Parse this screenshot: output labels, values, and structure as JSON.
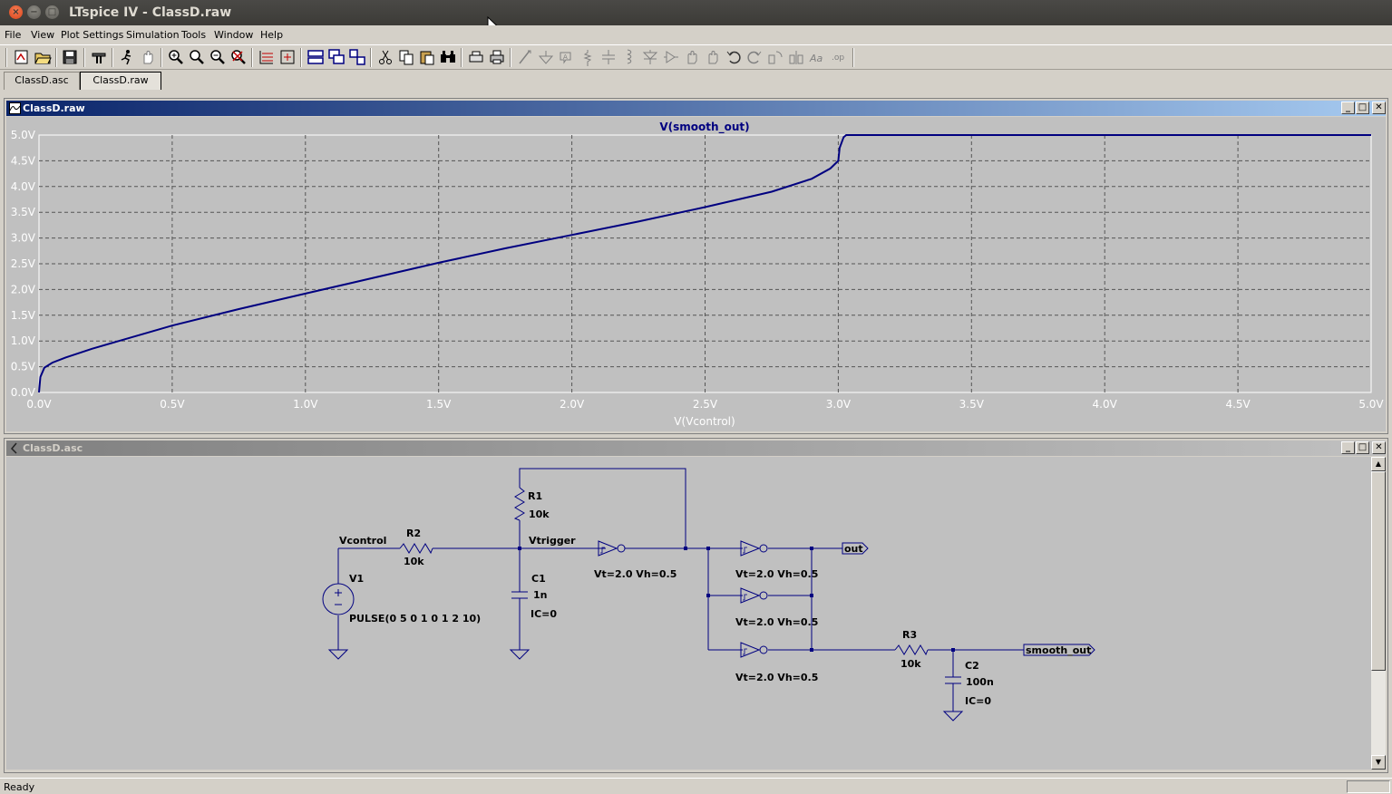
{
  "window": {
    "title": "LTspice IV - ClassD.raw"
  },
  "menu": [
    "File",
    "View",
    "Plot Settings",
    "Simulation",
    "Tools",
    "Window",
    "Help"
  ],
  "toolbar_icons": [
    "new-schematic-icon",
    "open-icon",
    "save-icon",
    "control-panel-icon",
    "run-icon",
    "halt-icon",
    "zoom-in-icon",
    "zoom-pan-icon",
    "zoom-out-icon",
    "zoom-cancel-icon",
    "autorange-icon",
    "zoom-extents-icon",
    "tile-horizontal-icon",
    "cascade-icon",
    "tile-vertical-icon",
    "cut-icon",
    "copy-icon",
    "paste-icon",
    "find-icon",
    "print-setup-icon",
    "print-icon",
    "wire-icon",
    "ground-icon",
    "label-net-icon",
    "resistor-icon",
    "capacitor-icon",
    "inductor-icon",
    "diode-icon",
    "component-icon",
    "move-icon",
    "drag-icon",
    "undo-icon",
    "redo-icon",
    "rotate-icon",
    "mirror-icon",
    "text-icon",
    "spice-directive-icon"
  ],
  "tabs": [
    {
      "label": "ClassD.asc",
      "active": false
    },
    {
      "label": "ClassD.raw",
      "active": true
    }
  ],
  "waveform_window": {
    "title": "ClassD.raw",
    "controls": {
      "minimize": "_",
      "maximize": "□",
      "close": "✕"
    }
  },
  "schematic_window": {
    "title": "ClassD.asc",
    "controls": {
      "minimize": "_",
      "maximize": "□",
      "close": "✕"
    }
  },
  "chart_data": {
    "type": "line",
    "title": "V(smooth_out)",
    "xlabel": "V(Vcontrol)",
    "ylabel": "",
    "xlim": [
      0,
      5
    ],
    "ylim": [
      0,
      5
    ],
    "x_ticks": [
      "0.0V",
      "0.5V",
      "1.0V",
      "1.5V",
      "2.0V",
      "2.5V",
      "3.0V",
      "3.5V",
      "4.0V",
      "4.5V",
      "5.0V"
    ],
    "y_ticks": [
      "0.0V",
      "0.5V",
      "1.0V",
      "1.5V",
      "2.0V",
      "2.5V",
      "3.0V",
      "3.5V",
      "4.0V",
      "4.5V",
      "5.0V"
    ],
    "grid": true,
    "series_color": "#000080",
    "series": [
      {
        "x": [
          0.0,
          0.005,
          0.02,
          0.05,
          0.1,
          0.2,
          0.3,
          0.5,
          0.75,
          1.0,
          1.25,
          1.5,
          1.75,
          2.0,
          2.25,
          2.5,
          2.75,
          2.9,
          2.97,
          3.0,
          3.005,
          3.02,
          3.03,
          5.0
        ],
        "y": [
          0.0,
          0.3,
          0.48,
          0.58,
          0.68,
          0.85,
          1.0,
          1.3,
          1.62,
          1.92,
          2.22,
          2.52,
          2.8,
          3.06,
          3.32,
          3.6,
          3.9,
          4.15,
          4.35,
          4.5,
          4.75,
          4.96,
          5.0,
          5.0
        ]
      }
    ]
  },
  "schematic": {
    "net_labels": {
      "vcontrol": "Vcontrol",
      "vtrigger": "Vtrigger",
      "out": "out",
      "smooth_out": "smooth_out"
    },
    "r1": {
      "name": "R1",
      "value": "10k"
    },
    "r2": {
      "name": "R2",
      "value": "10k"
    },
    "r3": {
      "name": "R3",
      "value": "10k"
    },
    "c1": {
      "name": "C1",
      "value": "1n",
      "ic": "IC=0"
    },
    "c2": {
      "name": "C2",
      "value": "100n",
      "ic": "IC=0"
    },
    "v1": {
      "name": "V1",
      "value": "PULSE(0 5 0 1 0 1 2 10)"
    },
    "gate_params": {
      "u1": "Vt=2.0 Vh=0.5",
      "u2": "Vt=2.0 Vh=0.5",
      "u3": "Vt=2.0 Vh=0.5",
      "u4": "Vt=2.0 Vh=0.5"
    }
  },
  "status": {
    "text": "Ready"
  }
}
